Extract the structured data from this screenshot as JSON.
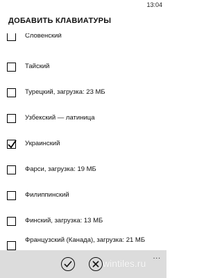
{
  "status_bar": {
    "time": "13:04"
  },
  "page": {
    "title": "ДОБАВИТЬ КЛАВИАТУРЫ"
  },
  "keyboards": [
    {
      "label": "Словенский",
      "checked": false
    },
    {
      "label": "Тайский",
      "checked": false
    },
    {
      "label": "Турецкий, загрузка: 23 МБ",
      "checked": false
    },
    {
      "label": "Узбекский — латиница",
      "checked": false
    },
    {
      "label": "Украинский",
      "checked": true
    },
    {
      "label": "Фарси, загрузка: 19 МБ",
      "checked": false
    },
    {
      "label": "Филиппинский",
      "checked": false
    },
    {
      "label": "Финский, загрузка: 13 МБ",
      "checked": false
    },
    {
      "label": "Французский (Канада), загрузка: 21 МБ",
      "checked": false
    }
  ],
  "app_bar": {
    "confirm_icon": "check-icon",
    "cancel_icon": "close-icon",
    "more": "..."
  },
  "watermark": "wintiles.ru"
}
